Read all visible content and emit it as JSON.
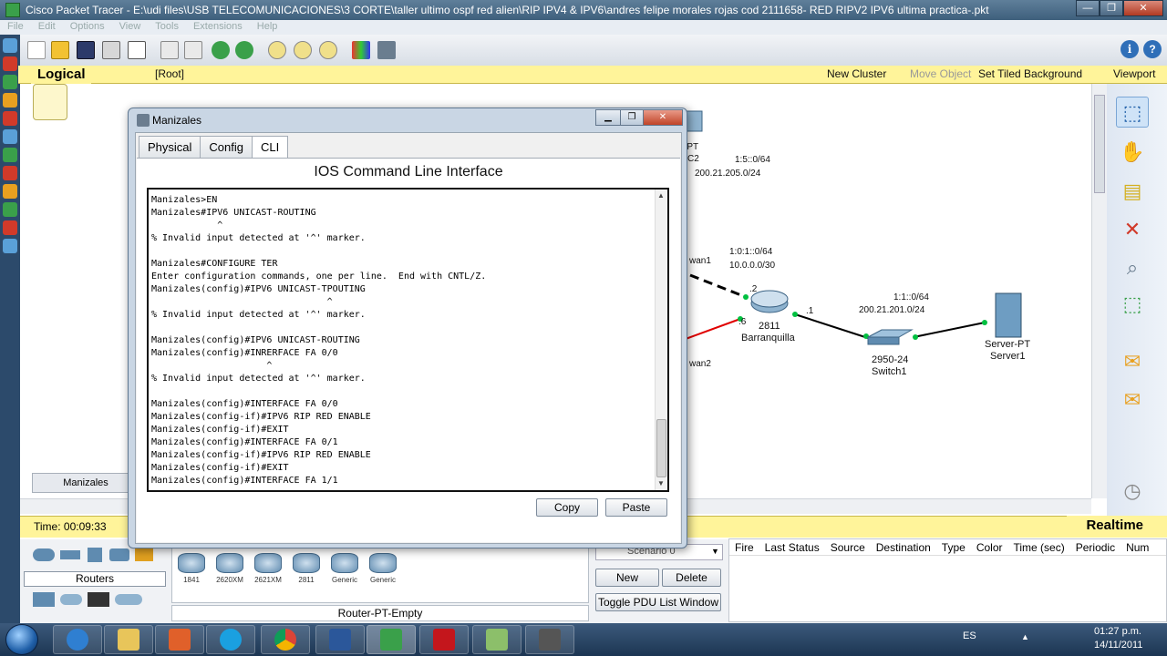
{
  "window": {
    "title": "Cisco Packet Tracer - E:\\udi files\\USB TELECOMUNICACIONES\\3 CORTE\\taller ultimo ospf red alien\\RIP IPV4 & IPV6\\andres felipe morales rojas cod 2111658- RED RIPV2 IPV6  ultima practica-.pkt",
    "minimize": "—",
    "maximize": "❐",
    "close": "✕"
  },
  "menu": [
    "File",
    "Edit",
    "Options",
    "View",
    "Tools",
    "Extensions",
    "Help"
  ],
  "workspace_bar": {
    "logical": "Logical",
    "root": "[Root]",
    "new_cluster": "New Cluster",
    "move_object": "Move Object",
    "set_tiled_background": "Set Tiled Background",
    "viewport": "Viewport"
  },
  "topology": {
    "labels": {
      "pt_frag": "-PT",
      "c2_frag": "C2",
      "net_205": "200.21.205.0/24",
      "ipv6_5": "1:5::0/64",
      "wan1_frag": "wan1",
      "ipv6_1_0_1": "1:0:1::0/64",
      "net_10": "10.0.0.0/30",
      "port_2": ".2",
      "port_6": ".6",
      "port_1": ".1",
      "router_model": "2811",
      "router_name": "Barranquilla",
      "wan2_frag": "wan2",
      "ipv6_1_1": "1:1::0/64",
      "net_201": "200.21.201.0/24",
      "switch_model": "2950-24",
      "switch_name": "Switch1",
      "server_model": "Server-PT",
      "server_name": "Server1"
    },
    "colors": {
      "link": "#000000",
      "serial": "#e00000",
      "port_up": "#00c040"
    }
  },
  "manizales_tab": "Manizales",
  "time_bar": {
    "time": "Time: 00:09:33",
    "mode": "Realtime"
  },
  "device_panel": {
    "category": "Routers",
    "devices": [
      "1841",
      "2620XM",
      "2621XM",
      "2811",
      "Generic",
      "Generic"
    ],
    "selected_name": "Router-PT-Empty"
  },
  "scenario": {
    "select": "Scenario 0",
    "new": "New",
    "delete": "Delete",
    "toggle": "Toggle PDU List Window"
  },
  "pdu_columns": [
    "Fire",
    "Last Status",
    "Source",
    "Destination",
    "Type",
    "Color",
    "Time (sec)",
    "Periodic",
    "Num"
  ],
  "dialog": {
    "title": "Manizales",
    "tabs": [
      "Physical",
      "Config",
      "CLI"
    ],
    "active_tab": "CLI",
    "heading": "IOS Command Line Interface",
    "cli": "Manizales>EN\nManizales#IPV6 UNICAST-ROUTING\n            ^\n% Invalid input detected at '^' marker.\n\nManizales#CONFIGURE TER\nEnter configuration commands, one per line.  End with CNTL/Z.\nManizales(config)#IPV6 UNICAST-TPOUTING\n                                ^\n% Invalid input detected at '^' marker.\n\nManizales(config)#IPV6 UNICAST-ROUTING\nManizales(config)#INRERFACE FA 0/0\n                     ^\n% Invalid input detected at '^' marker.\n\nManizales(config)#INTERFACE FA 0/0\nManizales(config-if)#IPV6 RIP RED ENABLE\nManizales(config-if)#EXIT\nManizales(config)#INTERFACE FA 0/1\nManizales(config-if)#IPV6 RIP RED ENABLE\nManizales(config-if)#EXIT\nManizales(config)#INTERFACE FA 1/1",
    "copy": "Copy",
    "paste": "Paste"
  },
  "taskbar": {
    "lang": "ES",
    "time": "01:27 p.m.",
    "date": "14/11/2011"
  }
}
